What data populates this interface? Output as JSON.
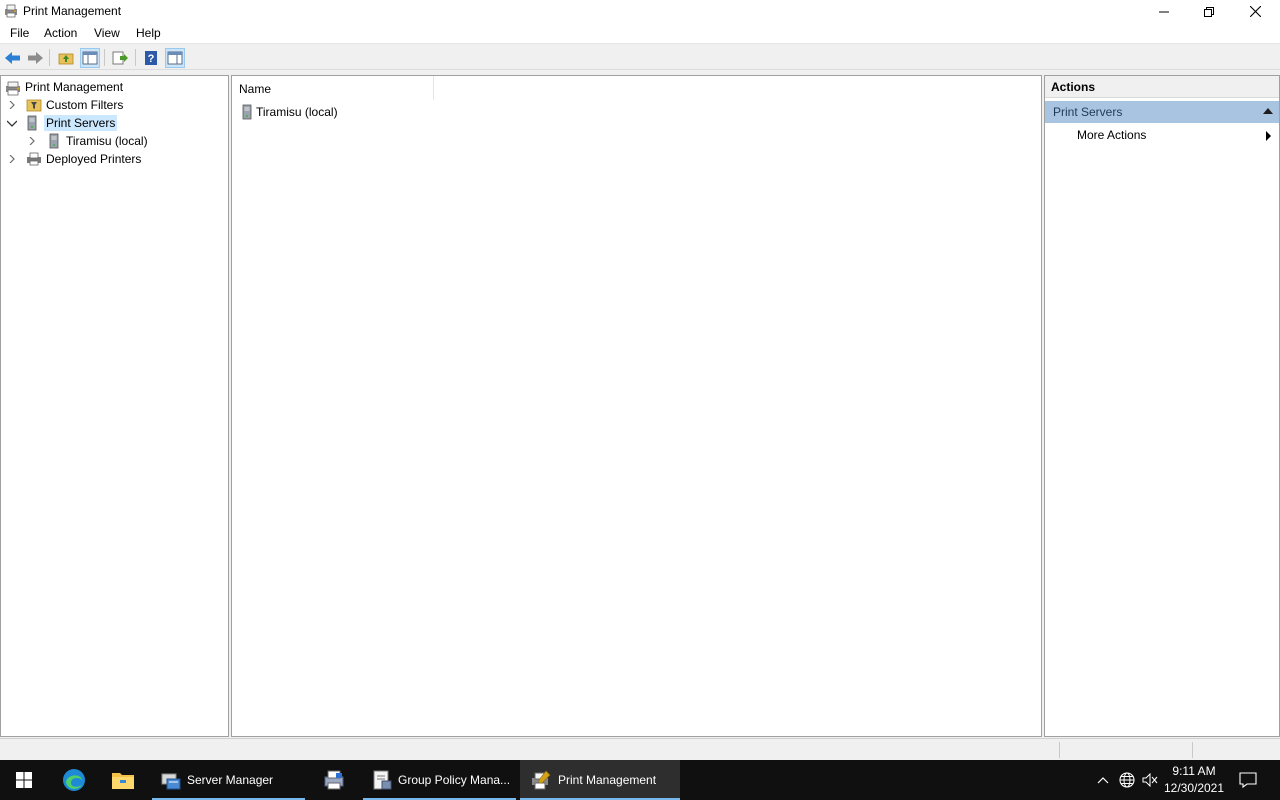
{
  "window": {
    "title": "Print Management",
    "controls": {
      "minimize": "minimize-icon",
      "restore": "restore-icon",
      "close": "close-icon"
    }
  },
  "menu": [
    "File",
    "Action",
    "View",
    "Help"
  ],
  "toolbar": [
    "back-icon",
    "forward-icon",
    "up-folder-icon",
    "show-hide-console-tree-icon",
    "export-list-icon",
    "help-icon",
    "show-hide-action-pane-icon"
  ],
  "tree": {
    "root": "Print Management",
    "items": {
      "custom_filters": "Custom Filters",
      "print_servers": "Print Servers",
      "tiramisu": "Tiramisu (local)",
      "deployed_printers": "Deployed Printers"
    }
  },
  "list": {
    "column_name": "Name",
    "rows": [
      "Tiramisu (local)"
    ]
  },
  "actions": {
    "title": "Actions",
    "section": "Print Servers",
    "more_actions": "More Actions"
  },
  "taskbar": {
    "apps": {
      "server_manager": "Server Manager",
      "group_policy": "Group Policy Mana...",
      "print_management": "Print Management"
    },
    "clock": {
      "time": "9:11 AM",
      "date": "12/30/2021"
    }
  },
  "colors": {
    "accent": "#76b9ed",
    "selection": "#cce8ff",
    "actions_header": "#a9c4e1",
    "taskbar": "#101010"
  }
}
